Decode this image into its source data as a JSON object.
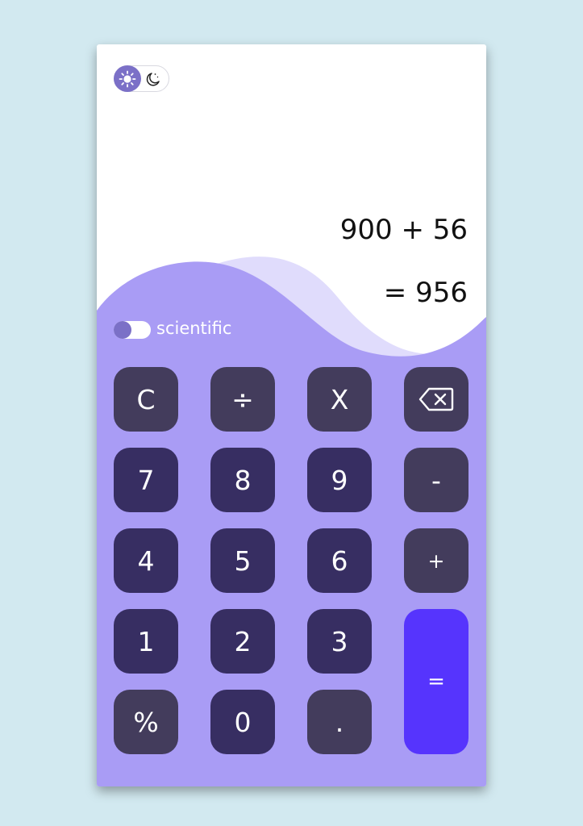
{
  "colors": {
    "page_bg": "#d2e9f0",
    "panel_bg": "#ffffff",
    "wave_main": "#a99cf5",
    "wave_light": "#e0dcfc",
    "key_number": "#372e62",
    "key_operator": "#433c5c",
    "key_equals": "#5634fd",
    "toggle_knob": "#7b70c7"
  },
  "theme_toggle": {
    "active": "light",
    "light_icon": "sun-icon",
    "dark_icon": "moon-icon"
  },
  "display": {
    "expression": "900 + 56",
    "result": "= 956"
  },
  "scientific": {
    "label": "scientific",
    "enabled": false
  },
  "keypad": {
    "clear": "C",
    "divide": "÷",
    "multiply": "X",
    "backspace_icon": "backspace-icon",
    "seven": "7",
    "eight": "8",
    "nine": "9",
    "minus": "-",
    "four": "4",
    "five": "5",
    "six": "6",
    "plus": "+",
    "one": "1",
    "two": "2",
    "three": "3",
    "equals": "=",
    "percent": "%",
    "zero": "0",
    "decimal": "."
  }
}
